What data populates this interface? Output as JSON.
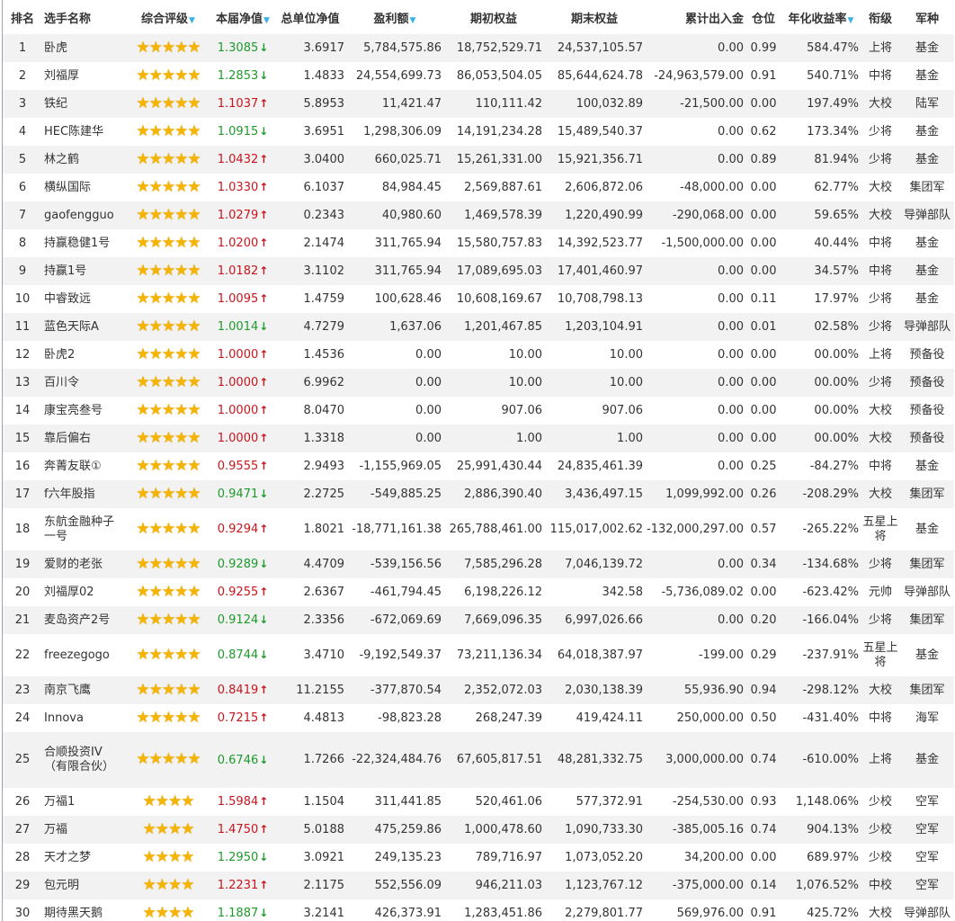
{
  "headers": {
    "rank": "排名",
    "name": "选手名称",
    "rating": "综合评级",
    "nav": "本届净值",
    "unit_nav": "总单位净值",
    "profit": "盈利额",
    "begin_equity": "期初权益",
    "end_equity": "期末权益",
    "net_flow": "累计出入金",
    "position": "仓位",
    "annual_return": "年化收益率",
    "rank_title": "衔级",
    "branch": "军种"
  },
  "sortable": [
    "rating",
    "nav",
    "unit_nav",
    "profit",
    "annual_return"
  ],
  "colors": {
    "nav_up": "#c8151d",
    "nav_down": "#1d9a2b",
    "star": "#f4b400",
    "sort_arrow": "#3ab0e8",
    "row_alt": "#f2f2f2"
  },
  "rows": [
    {
      "rank": "1",
      "name": "卧虎",
      "stars": 5,
      "nav": "1.3085",
      "dir": "down",
      "unit_nav": "3.6917",
      "profit": "5,784,575.86",
      "begin_equity": "18,752,529.71",
      "end_equity": "24,537,105.57",
      "net_flow": "0.00",
      "position": "0.99",
      "annual_return": "584.47%",
      "rank_title": "上将",
      "branch": "基金"
    },
    {
      "rank": "2",
      "name": "刘福厚",
      "stars": 5,
      "nav": "1.2853",
      "dir": "down",
      "unit_nav": "1.4833",
      "profit": "24,554,699.73",
      "begin_equity": "86,053,504.05",
      "end_equity": "85,644,624.78",
      "net_flow": "-24,963,579.00",
      "position": "0.91",
      "annual_return": "540.71%",
      "rank_title": "中将",
      "branch": "基金"
    },
    {
      "rank": "3",
      "name": "铁纪",
      "stars": 5,
      "nav": "1.1037",
      "dir": "up",
      "unit_nav": "5.8953",
      "profit": "11,421.47",
      "begin_equity": "110,111.42",
      "end_equity": "100,032.89",
      "net_flow": "-21,500.00",
      "position": "0.00",
      "annual_return": "197.49%",
      "rank_title": "大校",
      "branch": "陆军"
    },
    {
      "rank": "4",
      "name": "HEC陈建华",
      "stars": 5,
      "nav": "1.0915",
      "dir": "down",
      "unit_nav": "3.6951",
      "profit": "1,298,306.09",
      "begin_equity": "14,191,234.28",
      "end_equity": "15,489,540.37",
      "net_flow": "0.00",
      "position": "0.62",
      "annual_return": "173.34%",
      "rank_title": "少将",
      "branch": "基金"
    },
    {
      "rank": "5",
      "name": "林之鹤",
      "stars": 5,
      "nav": "1.0432",
      "dir": "up",
      "unit_nav": "3.0400",
      "profit": "660,025.71",
      "begin_equity": "15,261,331.00",
      "end_equity": "15,921,356.71",
      "net_flow": "0.00",
      "position": "0.89",
      "annual_return": "81.94%",
      "rank_title": "少将",
      "branch": "基金"
    },
    {
      "rank": "6",
      "name": "横纵国际",
      "stars": 5,
      "nav": "1.0330",
      "dir": "up",
      "unit_nav": "6.1037",
      "profit": "84,984.45",
      "begin_equity": "2,569,887.61",
      "end_equity": "2,606,872.06",
      "net_flow": "-48,000.00",
      "position": "0.00",
      "annual_return": "62.77%",
      "rank_title": "大校",
      "branch": "集团军"
    },
    {
      "rank": "7",
      "name": "gaofengguo",
      "stars": 5,
      "nav": "1.0279",
      "dir": "up",
      "unit_nav": "0.2343",
      "profit": "40,980.60",
      "begin_equity": "1,469,578.39",
      "end_equity": "1,220,490.99",
      "net_flow": "-290,068.00",
      "position": "0.00",
      "annual_return": "59.65%",
      "rank_title": "大校",
      "branch": "导弹部队"
    },
    {
      "rank": "8",
      "name": "持赢稳健1号",
      "stars": 5,
      "nav": "1.0200",
      "dir": "up",
      "unit_nav": "2.1474",
      "profit": "311,765.94",
      "begin_equity": "15,580,757.83",
      "end_equity": "14,392,523.77",
      "net_flow": "-1,500,000.00",
      "position": "0.00",
      "annual_return": "40.44%",
      "rank_title": "中将",
      "branch": "基金"
    },
    {
      "rank": "9",
      "name": "持赢1号",
      "stars": 5,
      "nav": "1.0182",
      "dir": "up",
      "unit_nav": "3.1102",
      "profit": "311,765.94",
      "begin_equity": "17,089,695.03",
      "end_equity": "17,401,460.97",
      "net_flow": "0.00",
      "position": "0.00",
      "annual_return": "34.57%",
      "rank_title": "中将",
      "branch": "基金"
    },
    {
      "rank": "10",
      "name": "中睿致远",
      "stars": 5,
      "nav": "1.0095",
      "dir": "up",
      "unit_nav": "1.4759",
      "profit": "100,628.46",
      "begin_equity": "10,608,169.67",
      "end_equity": "10,708,798.13",
      "net_flow": "0.00",
      "position": "0.11",
      "annual_return": "17.97%",
      "rank_title": "少将",
      "branch": "基金"
    },
    {
      "rank": "11",
      "name": "蓝色天际A",
      "stars": 5,
      "nav": "1.0014",
      "dir": "down",
      "unit_nav": "4.7279",
      "profit": "1,637.06",
      "begin_equity": "1,201,467.85",
      "end_equity": "1,203,104.91",
      "net_flow": "0.00",
      "position": "0.01",
      "annual_return": "02.58%",
      "rank_title": "少将",
      "branch": "导弹部队"
    },
    {
      "rank": "12",
      "name": "卧虎2",
      "stars": 5,
      "nav": "1.0000",
      "dir": "up",
      "unit_nav": "1.4536",
      "profit": "0.00",
      "begin_equity": "10.00",
      "end_equity": "10.00",
      "net_flow": "0.00",
      "position": "0.00",
      "annual_return": "00.00%",
      "rank_title": "上将",
      "branch": "预备役"
    },
    {
      "rank": "13",
      "name": "百川令",
      "stars": 5,
      "nav": "1.0000",
      "dir": "up",
      "unit_nav": "6.9962",
      "profit": "0.00",
      "begin_equity": "10.00",
      "end_equity": "10.00",
      "net_flow": "0.00",
      "position": "0.00",
      "annual_return": "00.00%",
      "rank_title": "少将",
      "branch": "预备役"
    },
    {
      "rank": "14",
      "name": "康宝亮叁号",
      "stars": 5,
      "nav": "1.0000",
      "dir": "up",
      "unit_nav": "8.0470",
      "profit": "0.00",
      "begin_equity": "907.06",
      "end_equity": "907.06",
      "net_flow": "0.00",
      "position": "0.00",
      "annual_return": "00.00%",
      "rank_title": "大校",
      "branch": "预备役"
    },
    {
      "rank": "15",
      "name": "靠后偏右",
      "stars": 5,
      "nav": "1.0000",
      "dir": "up",
      "unit_nav": "1.3318",
      "profit": "0.00",
      "begin_equity": "1.00",
      "end_equity": "1.00",
      "net_flow": "0.00",
      "position": "0.00",
      "annual_return": "00.00%",
      "rank_title": "大校",
      "branch": "预备役"
    },
    {
      "rank": "16",
      "name": "奔菁友联①",
      "stars": 5,
      "nav": "0.9555",
      "dir": "up",
      "unit_nav": "2.9493",
      "profit": "-1,155,969.05",
      "begin_equity": "25,991,430.44",
      "end_equity": "24,835,461.39",
      "net_flow": "0.00",
      "position": "0.25",
      "annual_return": "-84.27%",
      "rank_title": "中将",
      "branch": "基金"
    },
    {
      "rank": "17",
      "name": "f六年股指",
      "stars": 5,
      "nav": "0.9471",
      "dir": "down",
      "unit_nav": "2.2725",
      "profit": "-549,885.25",
      "begin_equity": "2,886,390.40",
      "end_equity": "3,436,497.15",
      "net_flow": "1,099,992.00",
      "position": "0.26",
      "annual_return": "-208.29%",
      "rank_title": "大校",
      "branch": "集团军"
    },
    {
      "rank": "18",
      "name": "东航金融种子一号",
      "stars": 5,
      "nav": "0.9294",
      "dir": "up",
      "unit_nav": "1.8021",
      "profit": "-18,771,161.38",
      "begin_equity": "265,788,461.00",
      "end_equity": "115,017,002.62",
      "net_flow": "-132,000,297.00",
      "position": "0.57",
      "annual_return": "-265.22%",
      "rank_title": "五星上将",
      "branch": "基金",
      "tall": true
    },
    {
      "rank": "19",
      "name": "爱财的老张",
      "stars": 5,
      "nav": "0.9289",
      "dir": "down",
      "unit_nav": "4.4709",
      "profit": "-539,156.56",
      "begin_equity": "7,585,296.28",
      "end_equity": "7,046,139.72",
      "net_flow": "0.00",
      "position": "0.34",
      "annual_return": "-134.68%",
      "rank_title": "少将",
      "branch": "集团军"
    },
    {
      "rank": "20",
      "name": "刘福厚02",
      "stars": 5,
      "nav": "0.9255",
      "dir": "up",
      "unit_nav": "2.6367",
      "profit": "-461,794.45",
      "begin_equity": "6,198,226.12",
      "end_equity": "342.58",
      "net_flow": "-5,736,089.02",
      "position": "0.00",
      "annual_return": "-623.42%",
      "rank_title": "元帅",
      "branch": "导弹部队"
    },
    {
      "rank": "21",
      "name": "麦岛资产2号",
      "stars": 5,
      "nav": "0.9124",
      "dir": "down",
      "unit_nav": "2.3356",
      "profit": "-672,069.69",
      "begin_equity": "7,669,096.35",
      "end_equity": "6,997,026.66",
      "net_flow": "0.00",
      "position": "0.20",
      "annual_return": "-166.04%",
      "rank_title": "少将",
      "branch": "集团军"
    },
    {
      "rank": "22",
      "name": "freezegogo",
      "stars": 5,
      "nav": "0.8744",
      "dir": "down",
      "unit_nav": "3.4710",
      "profit": "-9,192,549.37",
      "begin_equity": "73,211,136.34",
      "end_equity": "64,018,387.97",
      "net_flow": "-199.00",
      "position": "0.29",
      "annual_return": "-237.91%",
      "rank_title": "五星上将",
      "branch": "基金",
      "tall": true
    },
    {
      "rank": "23",
      "name": "南京飞鹰",
      "stars": 5,
      "nav": "0.8419",
      "dir": "up",
      "unit_nav": "11.2155",
      "profit": "-377,870.54",
      "begin_equity": "2,352,072.03",
      "end_equity": "2,030,138.39",
      "net_flow": "55,936.90",
      "position": "0.94",
      "annual_return": "-298.12%",
      "rank_title": "大校",
      "branch": "集团军"
    },
    {
      "rank": "24",
      "name": "Innova",
      "stars": 5,
      "nav": "0.7215",
      "dir": "up",
      "unit_nav": "4.4813",
      "profit": "-98,823.28",
      "begin_equity": "268,247.39",
      "end_equity": "419,424.11",
      "net_flow": "250,000.00",
      "position": "0.50",
      "annual_return": "-431.40%",
      "rank_title": "中将",
      "branch": "海军"
    },
    {
      "rank": "25",
      "name": "合顺投资IV（有限合伙）",
      "stars": 5,
      "nav": "0.6746",
      "dir": "down",
      "unit_nav": "1.7266",
      "profit": "-22,324,484.76",
      "begin_equity": "67,605,817.51",
      "end_equity": "48,281,332.75",
      "net_flow": "3,000,000.00",
      "position": "0.74",
      "annual_return": "-610.00%",
      "rank_title": "上将",
      "branch": "基金",
      "taller": true
    },
    {
      "rank": "26",
      "name": "万福1",
      "stars": 4,
      "nav": "1.5984",
      "dir": "up",
      "unit_nav": "1.1504",
      "profit": "311,441.85",
      "begin_equity": "520,461.06",
      "end_equity": "577,372.91",
      "net_flow": "-254,530.00",
      "position": "0.93",
      "annual_return": "1,148.06%",
      "rank_title": "少校",
      "branch": "空军"
    },
    {
      "rank": "27",
      "name": "万福",
      "stars": 4,
      "nav": "1.4750",
      "dir": "up",
      "unit_nav": "5.0188",
      "profit": "475,259.86",
      "begin_equity": "1,000,478.60",
      "end_equity": "1,090,733.30",
      "net_flow": "-385,005.16",
      "position": "0.74",
      "annual_return": "904.13%",
      "rank_title": "少校",
      "branch": "空军"
    },
    {
      "rank": "28",
      "name": "天才之梦",
      "stars": 4,
      "nav": "1.2950",
      "dir": "down",
      "unit_nav": "3.0921",
      "profit": "249,135.23",
      "begin_equity": "789,716.97",
      "end_equity": "1,073,052.20",
      "net_flow": "34,200.00",
      "position": "0.00",
      "annual_return": "689.97%",
      "rank_title": "少校",
      "branch": "空军"
    },
    {
      "rank": "29",
      "name": "包元明",
      "stars": 4,
      "nav": "1.2231",
      "dir": "up",
      "unit_nav": "2.1175",
      "profit": "552,556.09",
      "begin_equity": "946,211.03",
      "end_equity": "1,123,767.12",
      "net_flow": "-375,000.00",
      "position": "0.14",
      "annual_return": "1,076.52%",
      "rank_title": "中校",
      "branch": "空军"
    },
    {
      "rank": "30",
      "name": "期待黑天鹅",
      "stars": 4,
      "nav": "1.1887",
      "dir": "down",
      "unit_nav": "3.2141",
      "profit": "426,373.91",
      "begin_equity": "1,283,451.86",
      "end_equity": "2,279,801.77",
      "net_flow": "569,976.00",
      "position": "0.91",
      "annual_return": "425.72%",
      "rank_title": "大校",
      "branch": "导弹部队"
    }
  ]
}
